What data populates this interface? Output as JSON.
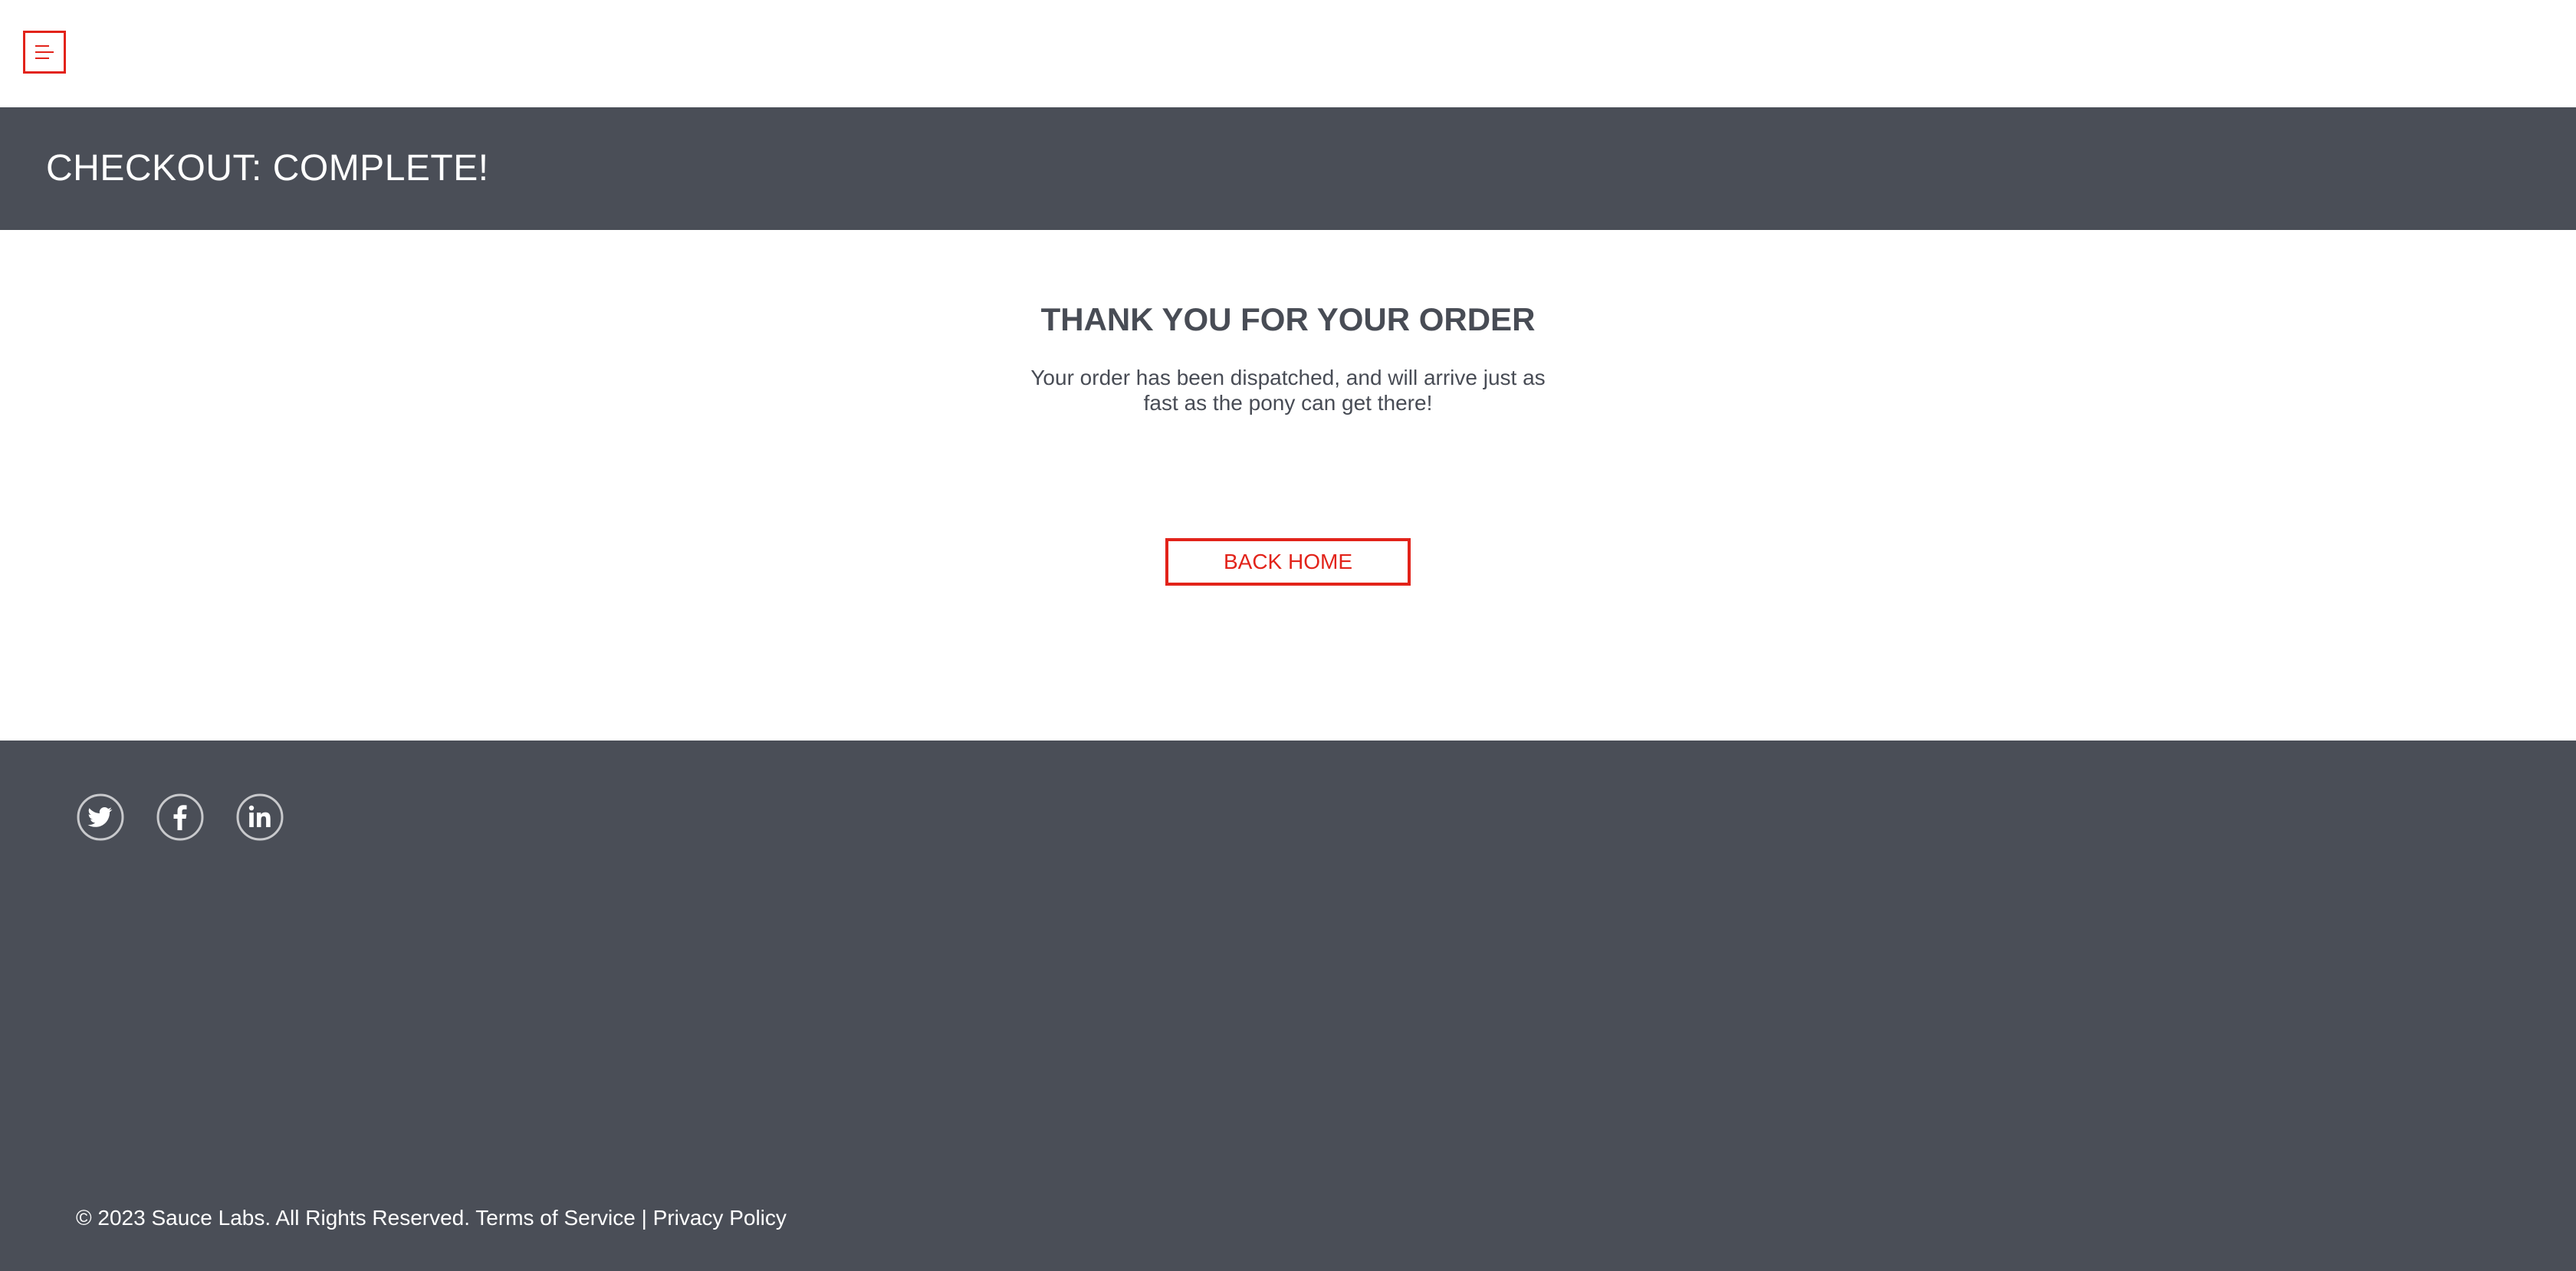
{
  "header": {
    "menu_icon": "hamburger-menu-icon",
    "accent_color": "#e2231a"
  },
  "title_band": {
    "title": "CHECKOUT: COMPLETE!",
    "background": "#4a4e57"
  },
  "complete": {
    "header": "THANK YOU FOR YOUR ORDER",
    "text": "Your order has been dispatched, and will arrive just as fast as the pony can get there!",
    "back_home_label": "BACK HOME"
  },
  "footer": {
    "social": [
      {
        "icon": "twitter-icon"
      },
      {
        "icon": "facebook-icon"
      },
      {
        "icon": "linkedin-icon"
      }
    ],
    "copy": "© 2023 Sauce Labs. All Rights Reserved. Terms of Service | Privacy Policy",
    "background": "#4a4e57"
  }
}
